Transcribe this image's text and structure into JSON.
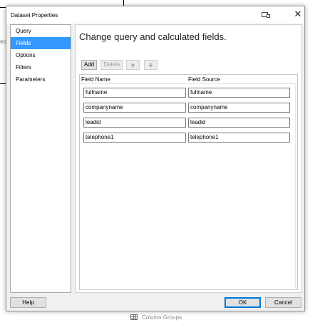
{
  "background": {
    "edge_text": "ed",
    "column_groups_label": "Column Groups"
  },
  "dialog": {
    "title": "Dataset Properties",
    "sidebar": [
      {
        "label": "Query"
      },
      {
        "label": "Fields",
        "selected": true
      },
      {
        "label": "Options"
      },
      {
        "label": "Filters"
      },
      {
        "label": "Parameters"
      }
    ],
    "heading": "Change query and calculated fields.",
    "toolbar": {
      "add_label": "Add",
      "delete_label": "Delete",
      "move_up_icon": "arrow-up-icon",
      "move_down_icon": "arrow-down-icon"
    },
    "fields_table": {
      "columns": [
        "Field Name",
        "Field Source"
      ],
      "rows": [
        {
          "name": "fullname",
          "source": "fullname"
        },
        {
          "name": "companyname",
          "source": "companyname"
        },
        {
          "name": "leadid",
          "source": "leadid"
        },
        {
          "name": "telephone1",
          "source": "telephone1"
        }
      ]
    },
    "buttons": {
      "help_label": "Help",
      "ok_label": "OK",
      "cancel_label": "Cancel"
    },
    "colors": {
      "selection": "#3399ff",
      "default_button_border": "#0078d7"
    }
  }
}
